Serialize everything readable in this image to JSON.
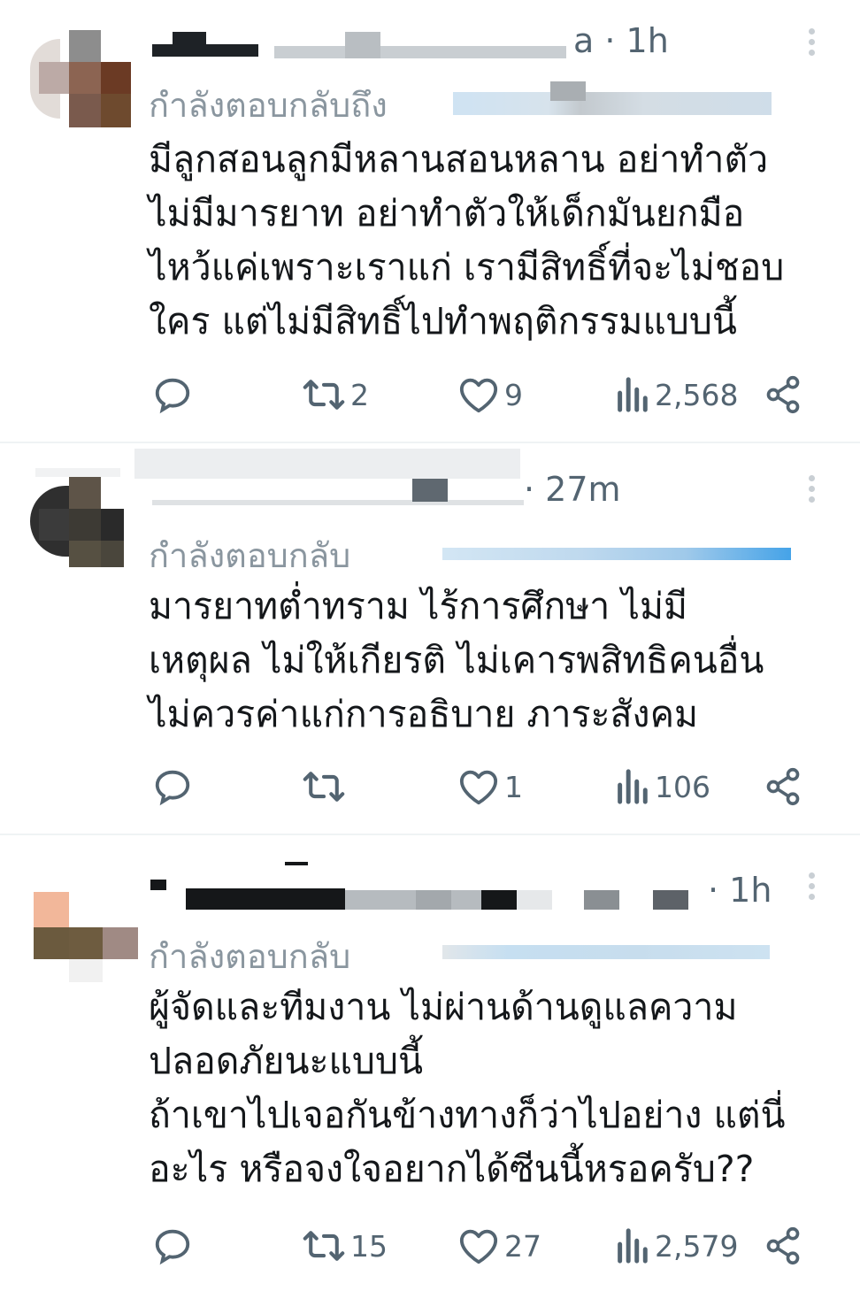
{
  "tweets": [
    {
      "time": "a · 1h",
      "replying_to": "กำลังตอบกลับถึง",
      "body_lines": [
        "มีลูกสอนลูกมีหลานสอนหลาน อย่าทำตัว",
        "ไม่มีมารยาท อย่าทำตัวให้เด็กมันยกมือ",
        "ไหว้แค่เพราะเราแก่ เรามีสิทธิ์ที่จะไม่ชอบ",
        "ใคร แต่ไม่มีสิทธิ์ไปทำพฤติกรรมแบบนี้"
      ],
      "retweets": "2",
      "likes": "9",
      "views": "2,568"
    },
    {
      "time": "· 27m",
      "replying_to": "กำลังตอบกลับ",
      "body_lines": [
        "มารยาทต่ำทราม ไร้การศึกษา ไม่มี",
        "เหตุผล ไม่ให้เกียรติ ไม่เคารพสิทธิคนอื่น",
        "ไม่ควรค่าแก่การอธิบาย ภาระสังคม"
      ],
      "retweets": "",
      "likes": "1",
      "views": "106"
    },
    {
      "time": "· 1h",
      "replying_to": "กำลังตอบกลับ",
      "body_lines": [
        "ผู้จัดและทีมงาน ไม่ผ่านด้านดูแลความ",
        "ปลอดภัยนะแบบนี้",
        "ถ้าเขาไปเจอกันข้างทางก็ว่าไปอย่าง แต่นี่",
        "อะไร หรือจงใจอยากได้ซีนนี้หรอครับ??"
      ],
      "retweets": "15",
      "likes": "27",
      "views": "2,579"
    }
  ],
  "icons": {
    "reply": "reply-icon",
    "retweet": "retweet-icon",
    "like": "heart-icon",
    "views": "views-icon",
    "share": "share-icon",
    "more": "more-icon"
  },
  "colors": {
    "text": "#14171a",
    "secondary": "#536471",
    "mention": "#1d9bf0",
    "divider": "#eff3f4"
  }
}
